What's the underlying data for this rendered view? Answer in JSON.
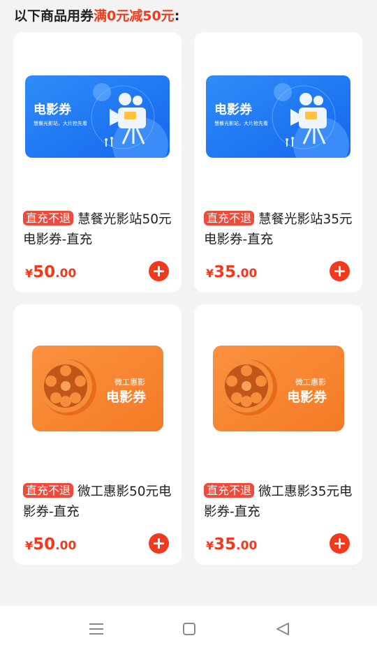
{
  "header": {
    "prefix": "以下商品用券",
    "highlight": "满0元减50元",
    "suffix": ":"
  },
  "colors": {
    "accent": "#f03a1e",
    "tag_bg": "#f24a3a",
    "banner_blue": "#1e7ff5",
    "banner_orange": "#f7862f"
  },
  "products": [
    {
      "tag": "直充不退",
      "title": "慧餐光影站50元电影券-直充",
      "price_symbol": "¥",
      "price_int": "50",
      "price_dec": ".00",
      "banner": {
        "heading": "电影券",
        "subtext": "慧餐光影站，大片抢先看"
      }
    },
    {
      "tag": "直充不退",
      "title": "慧餐光影站35元电影券-直充",
      "price_symbol": "¥",
      "price_int": "35",
      "price_dec": ".00",
      "banner": {
        "heading": "电影券",
        "subtext": "慧餐光影站，大片抢先看"
      }
    },
    {
      "tag": "直充不退",
      "title": "微工惠影50元电影券-直充",
      "price_symbol": "¥",
      "price_int": "50",
      "price_dec": ".00",
      "banner": {
        "subheading": "微工惠影",
        "heading": "电影券"
      }
    },
    {
      "tag": "直充不退",
      "title": "微工惠影35元电影券-直充",
      "price_symbol": "¥",
      "price_int": "35",
      "price_dec": ".00",
      "banner": {
        "subheading": "微工惠影",
        "heading": "电影券"
      }
    }
  ],
  "nav": {
    "icons": [
      "menu-icon",
      "home-square-icon",
      "back-triangle-icon"
    ]
  }
}
